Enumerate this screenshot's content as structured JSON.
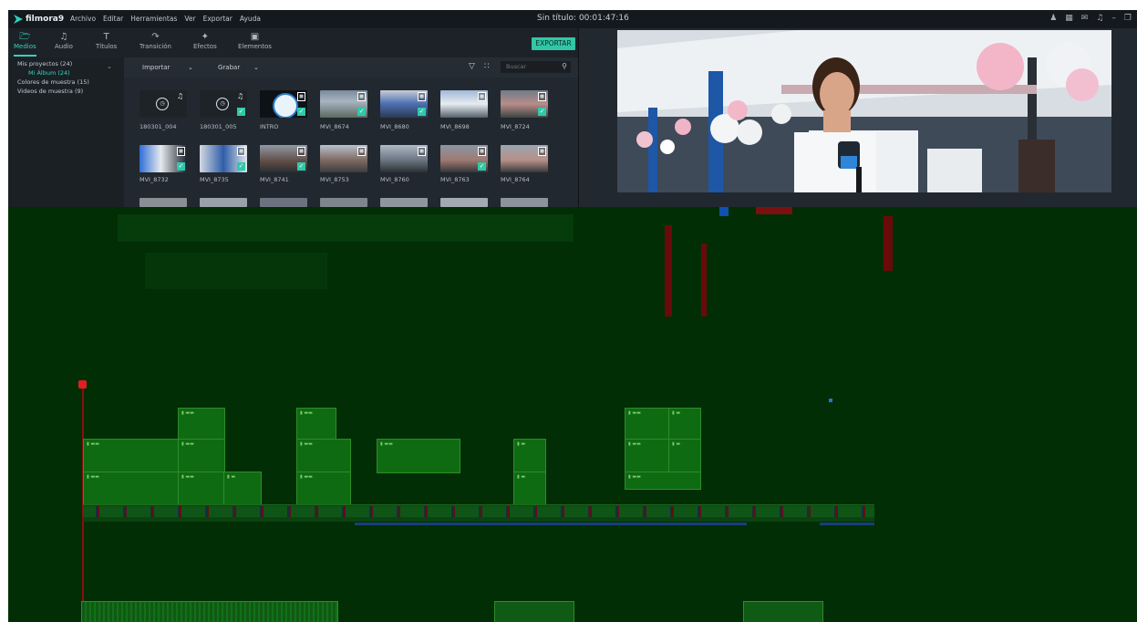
{
  "app": {
    "logo": "filmora9",
    "title": "Sin título: 00:01:47:16",
    "menu": [
      "Archivo",
      "Editar",
      "Herramientas",
      "Ver",
      "Exportar",
      "Ayuda"
    ]
  },
  "tabs": [
    {
      "label": "Medios",
      "icon": "folder-icon",
      "active": true
    },
    {
      "label": "Audio",
      "icon": "music-note-icon"
    },
    {
      "label": "Títulos",
      "icon": "text-icon"
    },
    {
      "label": "Transición",
      "icon": "transition-icon"
    },
    {
      "label": "Efectos",
      "icon": "effects-icon"
    },
    {
      "label": "Elementos",
      "icon": "elements-icon"
    }
  ],
  "export_label": "EXPORTAR",
  "sidebar": {
    "items": [
      {
        "label": "Mis proyectos (24)"
      },
      {
        "label": "Mi Álbum (24)",
        "selected": true
      },
      {
        "label": "Colores de muestra (15)"
      },
      {
        "label": "Videos de muestra (9)"
      }
    ]
  },
  "toolbar": {
    "import_label": "Importar",
    "record_label": "Grabar",
    "search_placeholder": "Buscar"
  },
  "media": [
    {
      "name": "180301_004",
      "kind": "audio"
    },
    {
      "name": "180301_005",
      "kind": "audio"
    },
    {
      "name": "INTRO",
      "kind": "video-logo"
    },
    {
      "name": "MVI_8674",
      "kind": "video"
    },
    {
      "name": "MVI_8680",
      "kind": "video"
    },
    {
      "name": "MVI_8698",
      "kind": "video"
    },
    {
      "name": "MVI_8724",
      "kind": "video"
    },
    {
      "name": "MVI_8732",
      "kind": "video"
    },
    {
      "name": "MVI_8735",
      "kind": "video"
    },
    {
      "name": "MVI_8741",
      "kind": "video"
    },
    {
      "name": "MVI_8753",
      "kind": "video"
    },
    {
      "name": "MVI_8760",
      "kind": "video"
    },
    {
      "name": "MVI_8763",
      "kind": "video"
    },
    {
      "name": "MVI_8764",
      "kind": "video"
    }
  ],
  "colors": {
    "accent": "#34d3bd",
    "export": "#31c7a6",
    "glitch_bg": "#012e05",
    "clip": "#0f6b12"
  }
}
